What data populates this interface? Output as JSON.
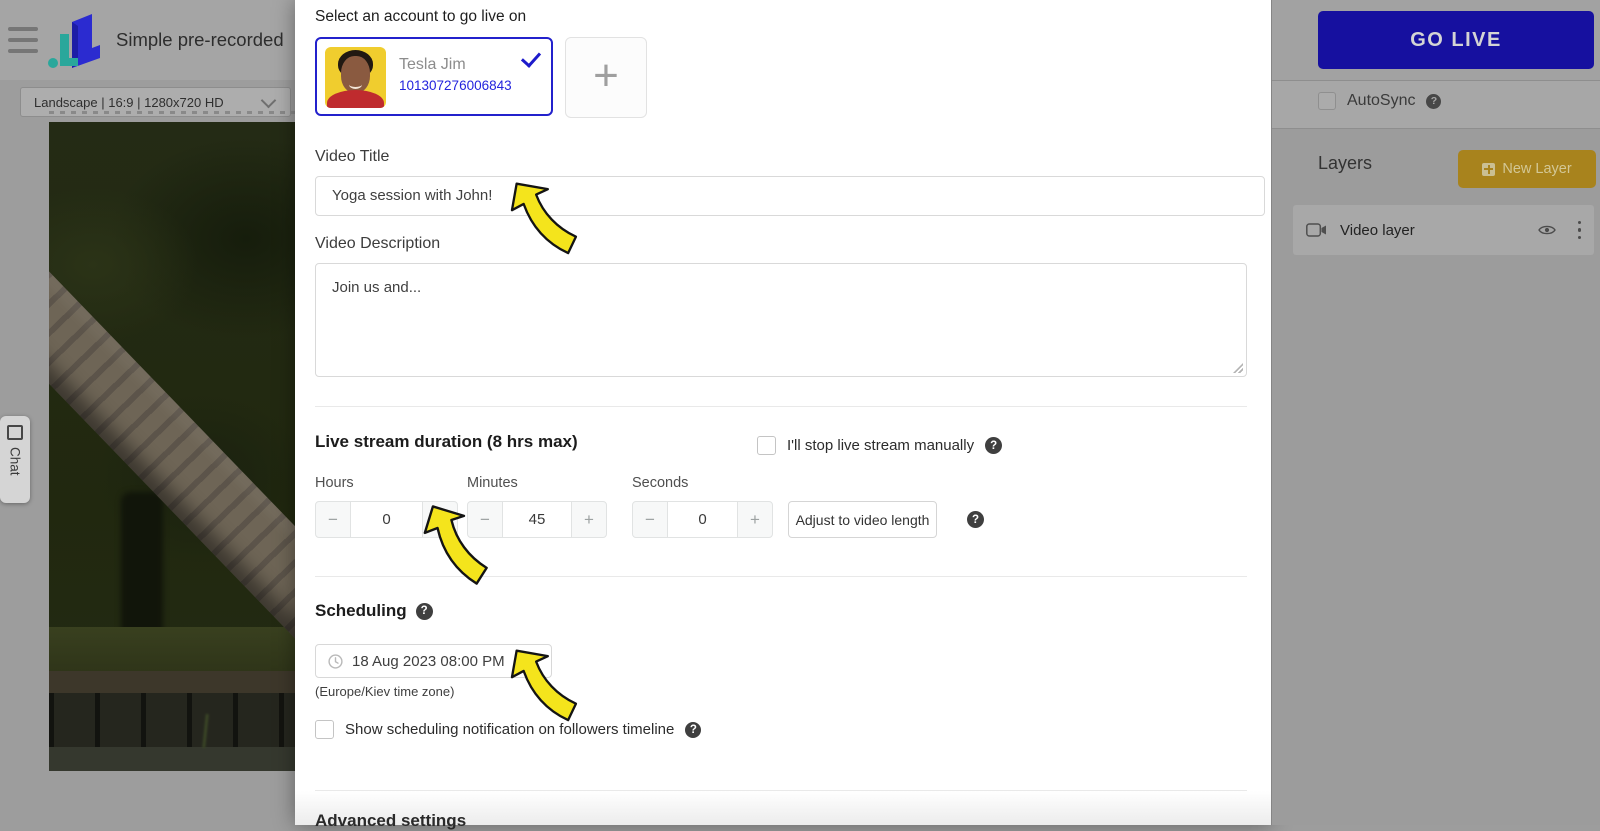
{
  "header": {
    "app_title": "Simple pre-recorded",
    "canvas_preset": "Landscape | 16:9 | 1280x720 HD"
  },
  "chat_tab": {
    "label": "Chat"
  },
  "modal": {
    "account_section": {
      "title": "Select an account to go live on",
      "account": {
        "name": "Tesla Jim",
        "id": "101307276006843",
        "selected": true
      }
    },
    "video_title": {
      "label": "Video Title",
      "value": "Yoga session with John!"
    },
    "video_description": {
      "label": "Video Description",
      "value": "Join us and..."
    },
    "duration": {
      "title": "Live stream duration (8 hrs max)",
      "manual_stop_label": "I'll stop live stream manually",
      "manual_stop_checked": false,
      "fields": [
        {
          "label": "Hours",
          "value": "0"
        },
        {
          "label": "Minutes",
          "value": "45"
        },
        {
          "label": "Seconds",
          "value": "0"
        }
      ],
      "adjust_button": "Adjust to video length"
    },
    "scheduling": {
      "title": "Scheduling",
      "datetime": "18 Aug 2023 08:00 PM",
      "timezone_note": "(Europe/Kiev time zone)",
      "notification_label": "Show scheduling notification on followers timeline",
      "notification_checked": false
    },
    "advanced_title": "Advanced settings"
  },
  "right_panel": {
    "go_live_button": "GO LIVE",
    "autosync_label": "AutoSync",
    "autosync_checked": false,
    "layers_title": "Layers",
    "new_layer_button": "New Layer",
    "layers": [
      {
        "name": "Video layer"
      }
    ]
  },
  "icons": {
    "help": "?",
    "plus": "+",
    "minus": "−"
  },
  "colors": {
    "accent_blue": "#2321cc",
    "go_live_navy": "#16109f",
    "new_layer_gold": "#a8831d",
    "annotation_yellow": "#f4e41c",
    "brand_blue": "#2b2bd0",
    "brand_teal": "#2aa79b"
  }
}
